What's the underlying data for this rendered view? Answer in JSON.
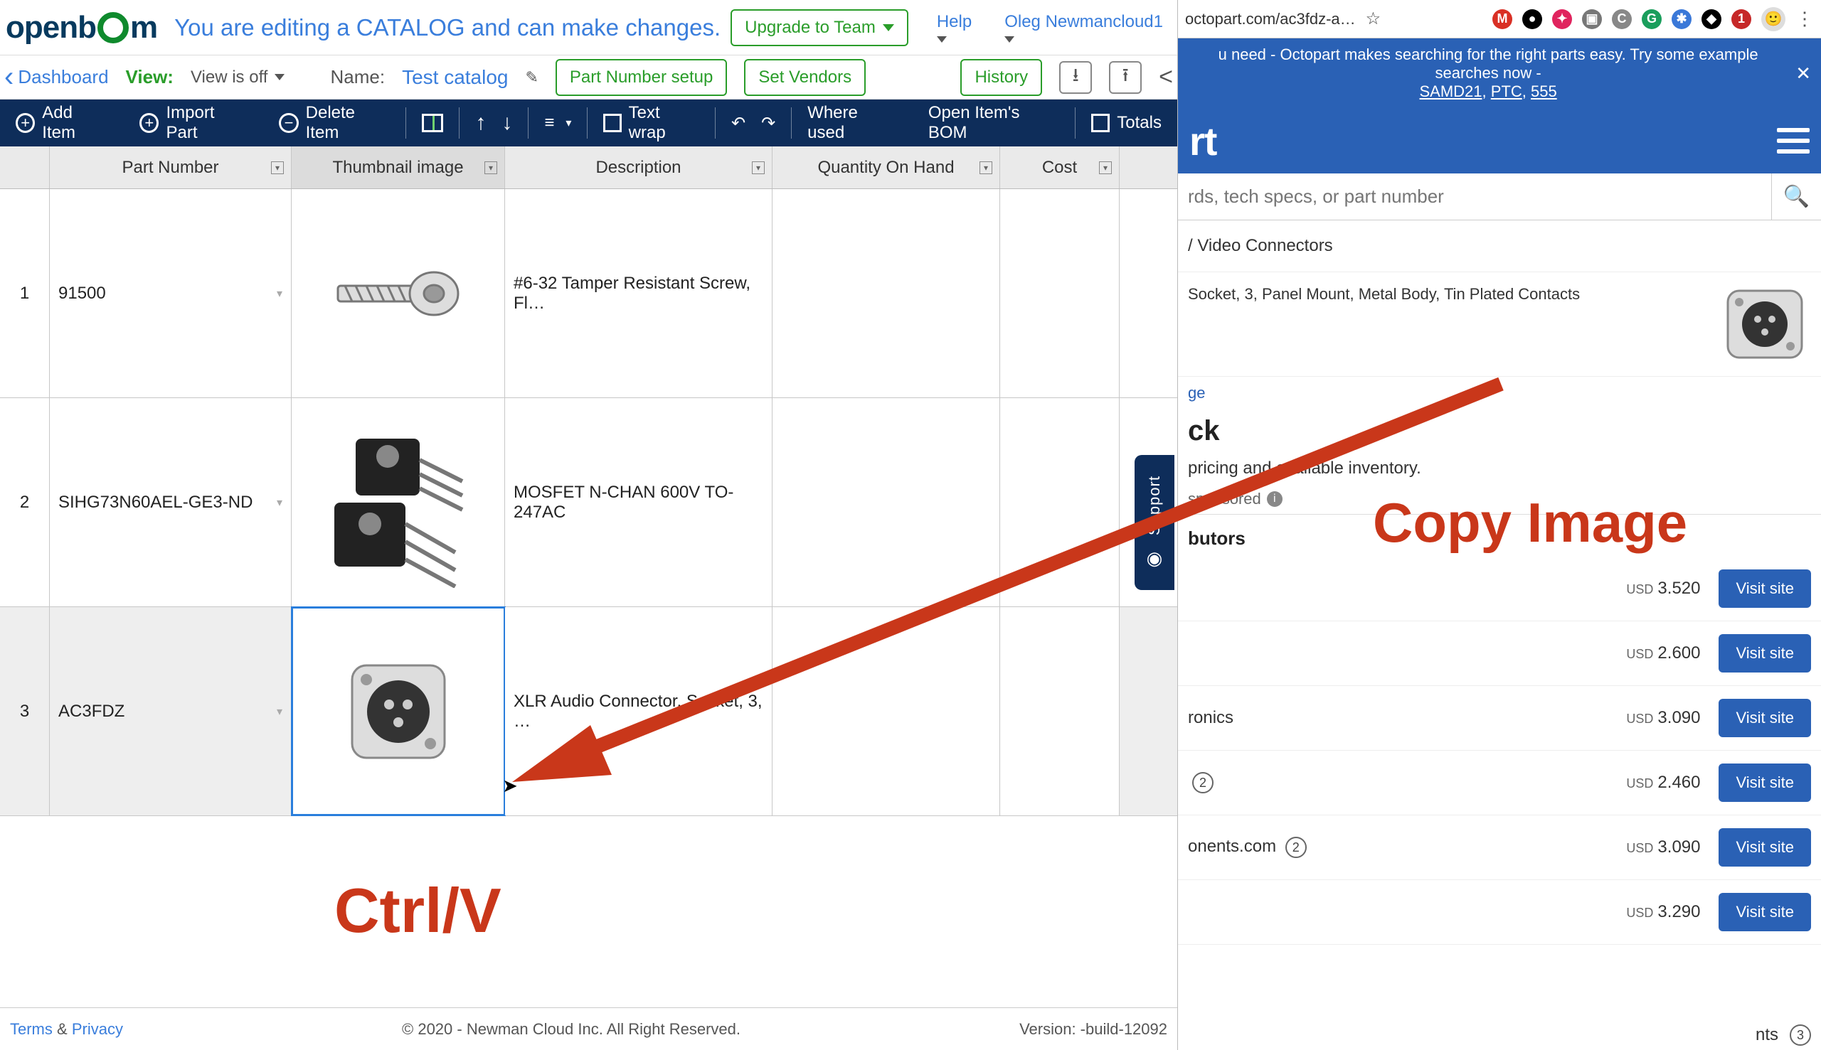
{
  "openbom": {
    "logo_text_pre": "openb",
    "logo_text_post": "m",
    "banner": "You are editing a CATALOG and can make changes.",
    "upgrade": "Upgrade to Team",
    "help": "Help",
    "user": "Oleg Newmancloud1",
    "dashboard": "Dashboard",
    "view_label": "View:",
    "view_value": "View is off",
    "name_label": "Name:",
    "name_value": "Test catalog",
    "part_number_setup": "Part Number setup",
    "set_vendors": "Set Vendors",
    "history": "History",
    "toolbar": {
      "add_item": "Add Item",
      "import_part": "Import Part",
      "delete_item": "Delete Item",
      "text_wrap": "Text wrap",
      "where_used": "Where used",
      "open_bom": "Open Item's BOM",
      "totals": "Totals"
    },
    "columns": {
      "part_number": "Part Number",
      "thumbnail": "Thumbnail image",
      "description": "Description",
      "qty": "Quantity On Hand",
      "cost": "Cost"
    },
    "rows": [
      {
        "idx": "1",
        "pn": "91500",
        "desc": "#6-32 Tamper Resistant Screw, Fl…",
        "qty": "",
        "cost": ""
      },
      {
        "idx": "2",
        "pn": "SIHG73N60AEL-GE3-ND",
        "desc": "MOSFET N-CHAN 600V TO-247AC",
        "qty": "",
        "cost": ""
      },
      {
        "idx": "3",
        "pn": "AC3FDZ",
        "desc": "XLR Audio Connector, Socket, 3, …",
        "qty": "",
        "cost": ""
      }
    ],
    "footer": {
      "terms": "Terms",
      "amp": "&",
      "privacy": "Privacy",
      "copyright": "© 2020 - Newman Cloud Inc. All Right Reserved.",
      "version": "Version: -build-12092"
    },
    "support": "Support"
  },
  "octopart": {
    "address": "octopart.com/ac3fdz-a…",
    "banner_text": "u need - Octopart makes searching for the right parts easy. Try some example searches now -",
    "banner_links": [
      "SAMD21",
      "PTC",
      "555"
    ],
    "logo_fragment": "rt",
    "search_placeholder": "rds, tech specs, or part number",
    "breadcrumb_fragment": "/ Video Connectors",
    "part_desc_fragment": "Socket, 3, Panel Mount, Metal Body, Tin Plated Contacts",
    "image_link_fragment": "ge",
    "stock_fragment": "ck",
    "pricing_fragment": "pricing and available inventory.",
    "sponsored_fragment": "sponsored",
    "distributors_header_fragment": "butors",
    "distributors": [
      {
        "name_fragment": "",
        "badge": "",
        "price": "3.520",
        "currency": "USD",
        "visit": "Visit site"
      },
      {
        "name_fragment": "",
        "badge": "",
        "price": "2.600",
        "currency": "USD",
        "visit": "Visit site"
      },
      {
        "name_fragment": "ronics",
        "badge": "",
        "price": "3.090",
        "currency": "USD",
        "visit": "Visit site"
      },
      {
        "name_fragment": "",
        "badge": "2",
        "price": "2.460",
        "currency": "USD",
        "visit": "Visit site"
      },
      {
        "name_fragment": "onents.com",
        "badge": "2",
        "price": "3.090",
        "currency": "USD",
        "visit": "Visit site"
      },
      {
        "name_fragment": "",
        "badge": "",
        "price": "3.290",
        "currency": "USD",
        "visit": "Visit site"
      }
    ],
    "ext_icons": [
      {
        "letter": "M",
        "bg": "#d93025"
      },
      {
        "letter": "",
        "bg": "#000"
      },
      {
        "letter": "",
        "bg": "#e0245e"
      },
      {
        "letter": "",
        "bg": "#777"
      },
      {
        "letter": "",
        "bg": "#888"
      },
      {
        "letter": "G",
        "bg": "#1a9e5c"
      },
      {
        "letter": "✱",
        "bg": "#3a78d8"
      },
      {
        "letter": "",
        "bg": "#000"
      },
      {
        "letter": "1",
        "bg": "#c62828"
      }
    ]
  },
  "annotations": {
    "ctrlv": "Ctrl/V",
    "copy_image": "Copy Image"
  }
}
